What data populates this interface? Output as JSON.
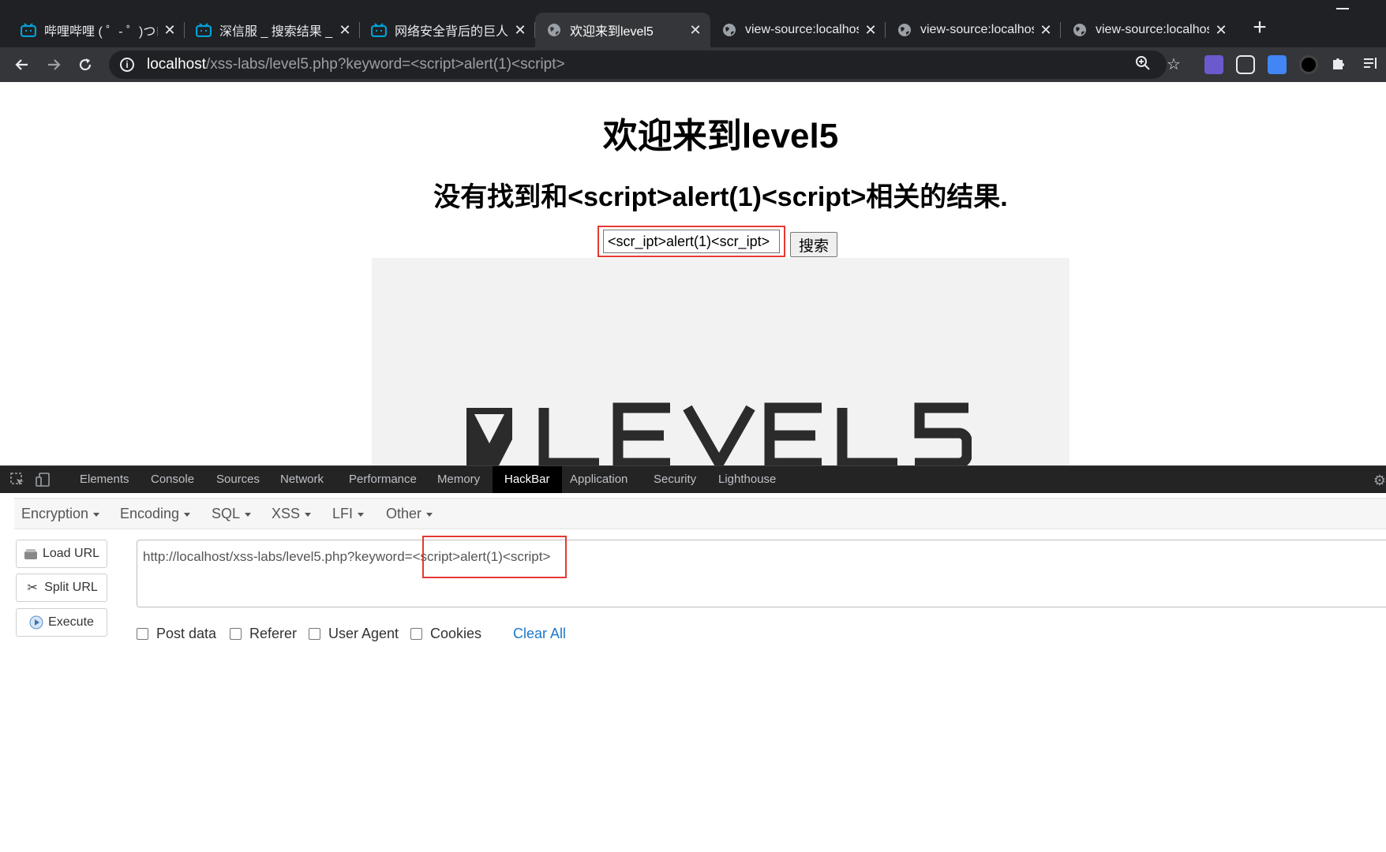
{
  "colors": {
    "chrome_dark": "#202124",
    "chrome_toolbar": "#35363a",
    "bilibili_blue": "#00a1d6",
    "highlight_red": "#e53935",
    "link_blue": "#1e78c8"
  },
  "tabs": [
    {
      "title": "哔哩哔哩 ( ゜- ゜)つロ",
      "icon": "bilibili-icon",
      "active": false
    },
    {
      "title": "深信服 _ 搜索结果 _ 哔",
      "icon": "bilibili-icon",
      "active": false
    },
    {
      "title": "网络安全背后的巨人-",
      "icon": "bilibili-icon",
      "active": false
    },
    {
      "title": "欢迎来到level5",
      "icon": "globe-icon",
      "active": true
    },
    {
      "title": "view-source:localhost",
      "icon": "globe-icon",
      "active": false
    },
    {
      "title": "view-source:localhost",
      "icon": "globe-icon",
      "active": false
    },
    {
      "title": "view-source:localhost",
      "icon": "globe-icon",
      "active": false
    }
  ],
  "address_bar": {
    "host": "localhost",
    "path": "/xss-labs/level5.php?keyword=<script>alert(1)<script>"
  },
  "page": {
    "heading": "欢迎来到level5",
    "result_text": "没有找到和<script>alert(1)<script>相关的结果.",
    "search_value": "<scr_ipt>alert(1)<scr_ipt>",
    "search_button": "搜索",
    "logo_text": "LEVEL5"
  },
  "devtools": {
    "tabs": [
      "Elements",
      "Console",
      "Sources",
      "Network",
      "Performance",
      "Memory",
      "HackBar",
      "Application",
      "Security",
      "Lighthouse"
    ],
    "active_tab": "HackBar"
  },
  "hackbar": {
    "menus": [
      "Encryption",
      "Encoding",
      "SQL",
      "XSS",
      "LFI",
      "Other"
    ],
    "buttons": {
      "load": "Load URL",
      "split": "Split URL",
      "execute": "Execute"
    },
    "url_prefix": "http://localhost/xss-labs/level5.php?keyword=",
    "url_payload": "<script>alert(1)<script>",
    "checkboxes": [
      "Post data",
      "Referer",
      "User Agent",
      "Cookies"
    ],
    "clear_all": "Clear All"
  }
}
